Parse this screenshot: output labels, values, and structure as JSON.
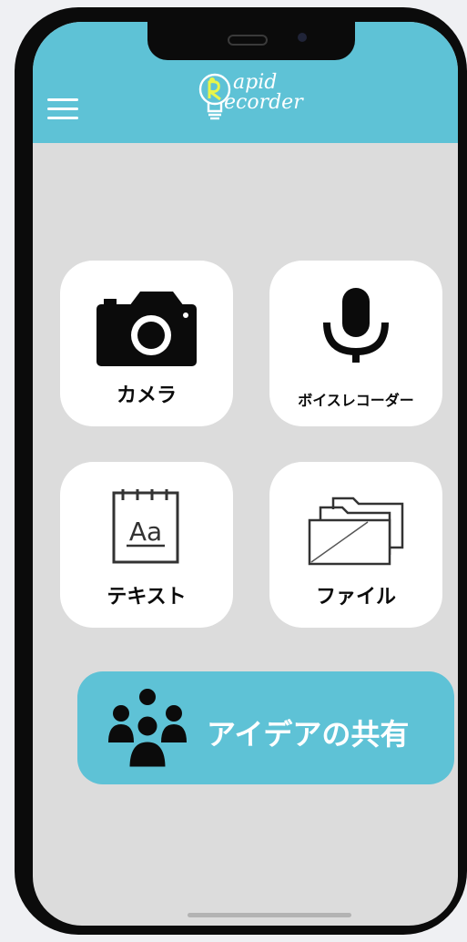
{
  "app": {
    "logo_line1": "apid",
    "logo_line2": "ecorder",
    "brand_color": "#5ec2d6",
    "background_color": "#dcdcdc"
  },
  "header": {
    "menu_icon": "hamburger-menu-icon"
  },
  "tiles": [
    {
      "label": "カメラ",
      "icon": "camera-icon"
    },
    {
      "label": "ボイスレコーダー",
      "icon": "microphone-icon"
    },
    {
      "label": "テキスト",
      "icon": "notebook-text-icon"
    },
    {
      "label": "ファイル",
      "icon": "folders-icon"
    }
  ],
  "share": {
    "label": "アイデアの共有",
    "icon": "group-people-icon"
  }
}
